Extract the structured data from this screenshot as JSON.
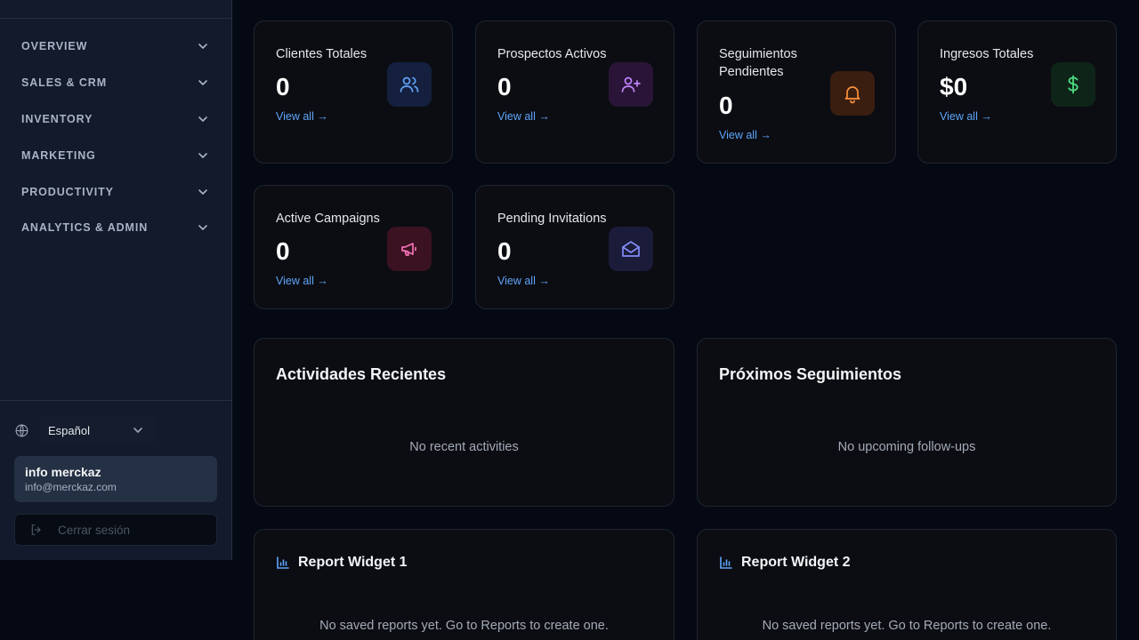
{
  "sidebar": {
    "nav": [
      {
        "label": "OVERVIEW",
        "icon": "chevron-down-icon"
      },
      {
        "label": "SALES & CRM",
        "icon": "chevron-down-icon"
      },
      {
        "label": "INVENTORY",
        "icon": "chevron-down-icon"
      },
      {
        "label": "MARKETING",
        "icon": "chevron-down-icon"
      },
      {
        "label": "PRODUCTIVITY",
        "icon": "chevron-down-icon"
      },
      {
        "label": "ANALYTICS & ADMIN",
        "icon": "chevron-down-icon"
      }
    ],
    "language": {
      "selected": "Español",
      "icon": "globe-icon"
    },
    "user": {
      "name": "info merckaz",
      "email": "info@merckaz.com"
    },
    "logout": {
      "label": "Cerrar sesión",
      "icon": "logout-icon"
    }
  },
  "stats": [
    {
      "title": "Clientes Totales",
      "value": "0",
      "link": "View all →",
      "icon": "users-icon",
      "accent": "#60a5fa"
    },
    {
      "title": "Prospectos Activos",
      "value": "0",
      "link": "View all →",
      "icon": "user-plus-icon",
      "accent": "#c084fc"
    },
    {
      "title": "Seguimientos Pendientes",
      "value": "0",
      "link": "View all →",
      "icon": "bell-icon",
      "accent": "#fb923c"
    },
    {
      "title": "Ingresos Totales",
      "value": "$0",
      "link": "View all →",
      "icon": "dollar-icon",
      "accent": "#4ade80"
    },
    {
      "title": "Active Campaigns",
      "value": "0",
      "link": "View all →",
      "icon": "megaphone-icon",
      "accent": "#f472b6"
    },
    {
      "title": "Pending Invitations",
      "value": "0",
      "link": "View all →",
      "icon": "mail-open-icon",
      "accent": "#818cf8"
    }
  ],
  "panels": {
    "recent": {
      "title": "Actividades Recientes",
      "empty": "No recent activities"
    },
    "followups": {
      "title": "Próximos Seguimientos",
      "empty": "No upcoming follow-ups"
    }
  },
  "widgets": [
    {
      "title": "Report Widget 1",
      "empty": "No saved reports yet. Go to Reports to create one.",
      "icon": "bar-chart-icon"
    },
    {
      "title": "Report Widget 2",
      "empty": "No saved reports yet. Go to Reports to create one.",
      "icon": "bar-chart-icon"
    }
  ],
  "colors": {
    "link": "#60a5fa",
    "background": "#050913",
    "sidebar": "#121a2b",
    "card": "#0b0d12"
  }
}
